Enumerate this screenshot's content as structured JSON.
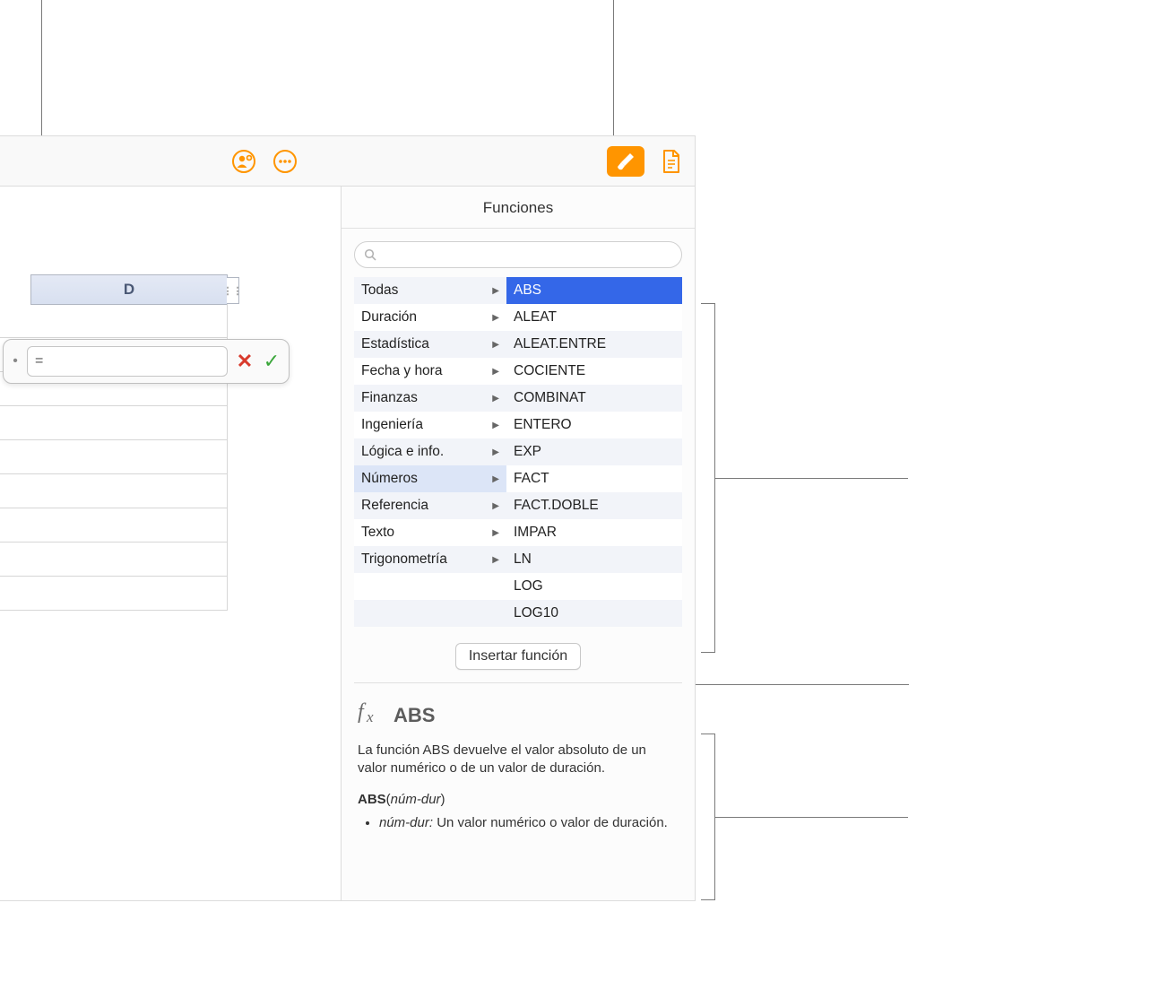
{
  "toolbar": {
    "share_icon": "share",
    "more_icon": "more",
    "format_icon": "format",
    "doc_icon": "document"
  },
  "sheet": {
    "column_header": "D",
    "formula_prefix": "="
  },
  "sidebar": {
    "title": "Funciones",
    "search_placeholder": "",
    "categories": [
      {
        "label": "Todas",
        "selected": false
      },
      {
        "label": "Duración",
        "selected": false
      },
      {
        "label": "Estadística",
        "selected": false
      },
      {
        "label": "Fecha y hora",
        "selected": false
      },
      {
        "label": "Finanzas",
        "selected": false
      },
      {
        "label": "Ingeniería",
        "selected": false
      },
      {
        "label": "Lógica e info.",
        "selected": false
      },
      {
        "label": "Números",
        "selected": true
      },
      {
        "label": "Referencia",
        "selected": false
      },
      {
        "label": "Texto",
        "selected": false
      },
      {
        "label": "Trigonometría",
        "selected": false
      },
      {
        "label": "",
        "selected": false
      },
      {
        "label": "",
        "selected": false
      }
    ],
    "functions": [
      {
        "label": "ABS",
        "selected": true
      },
      {
        "label": "ALEAT",
        "selected": false
      },
      {
        "label": "ALEAT.ENTRE",
        "selected": false
      },
      {
        "label": "COCIENTE",
        "selected": false
      },
      {
        "label": "COMBINAT",
        "selected": false
      },
      {
        "label": "ENTERO",
        "selected": false
      },
      {
        "label": "EXP",
        "selected": false
      },
      {
        "label": "FACT",
        "selected": false
      },
      {
        "label": "FACT.DOBLE",
        "selected": false
      },
      {
        "label": "IMPAR",
        "selected": false
      },
      {
        "label": "LN",
        "selected": false
      },
      {
        "label": "LOG",
        "selected": false
      },
      {
        "label": "LOG10",
        "selected": false
      }
    ],
    "insert_button": "Insertar función",
    "description": {
      "fx": "fx",
      "title": "ABS",
      "text": "La función ABS devuelve el valor absoluto de un valor numérico o de un valor de duración.",
      "syntax_name": "ABS",
      "syntax_arg": "núm-dur",
      "bullet_arg": "núm-dur:",
      "bullet_text": " Un valor numérico o valor de duración."
    }
  }
}
